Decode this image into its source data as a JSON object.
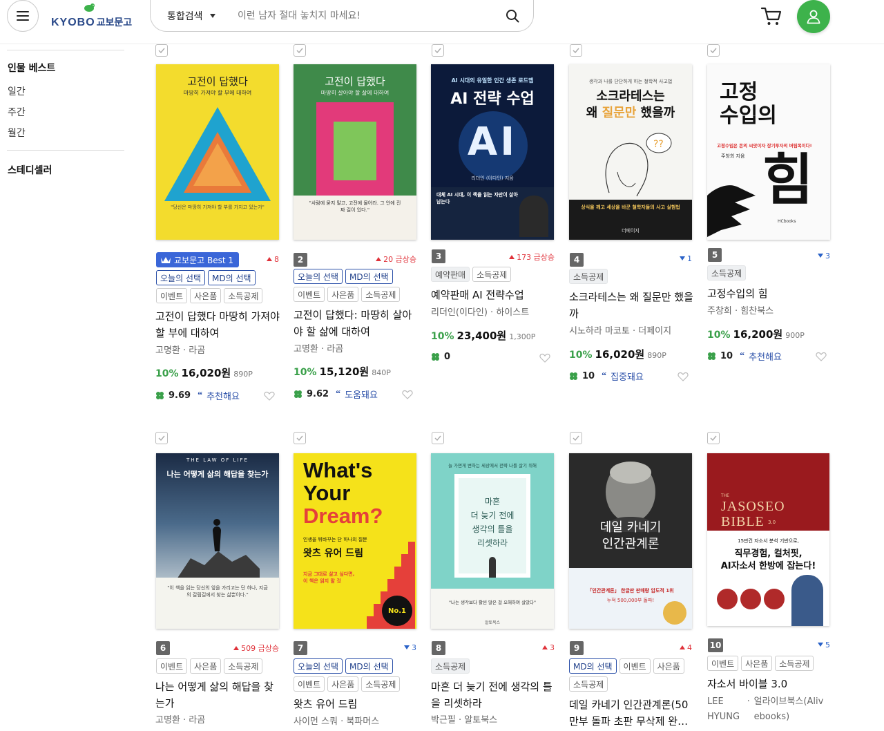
{
  "header": {
    "logo_en": "KYOBO",
    "logo_ko": "교보문고",
    "search_scope": "통합검색",
    "search_placeholder": "이런 남자 절대 놓치지 마세요!"
  },
  "sidebar": {
    "section1": "인물 베스트",
    "items": [
      "일간",
      "주간",
      "월간"
    ],
    "section2": "스테디셀러"
  },
  "books": [
    {
      "rank": "1",
      "best_badge": "교보문고 Best 1",
      "change": "8",
      "change_dir": "up",
      "tags_blue": [
        "오늘의 선택",
        "MD의 선택"
      ],
      "tags": [
        "이벤트",
        "사은품",
        "소득공제"
      ],
      "title": "고전이 답했다 마땅히 가져야 할 부에 대하여",
      "author": "고명환",
      "publisher": "라곰",
      "discount": "10%",
      "price": "16,020원",
      "points": "890P",
      "score": "9.69",
      "review": "추천해요",
      "cover": {
        "top": "고전이 답했다",
        "sub": "마땅히 가져야 할 부에 대하여",
        "quote": "\"당신은 마땅히 가져야 할 부를 가지고 있는가\"",
        "bg": "#f3dc2d"
      }
    },
    {
      "rank": "2",
      "change": "20 급상승",
      "change_dir": "up",
      "tags_blue": [
        "오늘의 선택",
        "MD의 선택"
      ],
      "tags": [
        "이벤트",
        "사은품",
        "소득공제"
      ],
      "title": "고전이 답했다: 마땅히 살아야 할 삶에 대하여",
      "author": "고명환",
      "publisher": "라곰",
      "discount": "10%",
      "price": "15,120원",
      "points": "840P",
      "score": "9.62",
      "review": "도움돼요",
      "cover": {
        "top": "고전이 답했다",
        "sub": "마땅히 살아야 할 삶에 대하여",
        "quote": "\"사람에 묻지 말고, 고전에 물어라. 그 안에 진짜 길이 있다.\"",
        "bg": "#3f8a4a"
      }
    },
    {
      "rank": "3",
      "change": "173 급상승",
      "change_dir": "up",
      "tags_gray": [
        "예약판매",
        "소득공제"
      ],
      "title": "예약판매 AI 전략수업",
      "author": "리더인(이다인)",
      "publisher": "하이스트",
      "discount": "10%",
      "price": "23,400원",
      "points": "1,300P",
      "score": "0",
      "cover": {
        "top": "AI 시대의 유일한 인간 생존 로드맵",
        "big": "AI 전략 수업",
        "ai": "AI",
        "foot": "대체 AI 시대, 이 책을 읽는 자만이 살아남는다",
        "author": "리더인 (이다인) 지음"
      }
    },
    {
      "rank": "4",
      "change": "1",
      "change_dir": "down",
      "tags_gray": [
        "소득공제"
      ],
      "title": "소크라테스는 왜 질문만 했을까",
      "author": "시노하라 마코토",
      "publisher": "더페이지",
      "discount": "10%",
      "price": "16,020원",
      "points": "890P",
      "score": "10",
      "review": "집중돼요",
      "cover": {
        "top": "생각과 나를 단단하게 하는 철학적 사고법",
        "big1": "소크라테스는",
        "big2a": "왜 ",
        "big2b": "질문만",
        "big2c": " 했을까",
        "foot": "상식을 깨고 세상을 바꾼 철학자들의 사고 실험법",
        "pub": "더페이지"
      }
    },
    {
      "rank": "5",
      "change": "3",
      "change_dir": "down",
      "tags_gray": [
        "소득공제"
      ],
      "title": "고정수입의 힘",
      "author": "주창희",
      "publisher": "힘찬북스",
      "discount": "10%",
      "price": "16,200원",
      "points": "900P",
      "score": "10",
      "review": "추천해요",
      "cover": {
        "big1": "고정",
        "big2": "수입의",
        "red": "고정수입은 돈의 씨앗이자 장기투자의 버팀목이다!",
        "author": "주창희 지음",
        "huge": "힘",
        "pub": "HCbooks"
      }
    },
    {
      "rank": "6",
      "change": "509 급상승",
      "change_dir": "up",
      "tags_gray": [
        "이벤트",
        "사은품",
        "소득공제"
      ],
      "title": "나는 어떻게 삶의 해답을 찾는가",
      "author": "고명환",
      "publisher": "라곰",
      "cover": {
        "ribbon": "THE LAW OF LIFE",
        "big": "나는 어떻게 삶의 해답을 찾는가",
        "foot": "\"이 책을 읽는 당신의 앞을 가리고는 단 하나, 지금의 갈림길에서 찾는 삶뿐이다.\""
      }
    },
    {
      "rank": "7",
      "change": "3",
      "change_dir": "down",
      "tags_blue": [
        "오늘의 선택",
        "MD의 선택"
      ],
      "tags": [
        "이벤트",
        "사은품",
        "소득공제"
      ],
      "title": "왓츠 유어 드림",
      "author": "사이먼 스쿼",
      "publisher": "북파머스",
      "cover": {
        "l1": "What's",
        "l2": "Your",
        "l3": "Dream?",
        "sub": "인생을 뒤바꾸는 단 하나의 질문",
        "ko": "왓츠 유어 드림",
        "red": "지금 그대로 살고 싶다면, 이 책은 읽지 말 것",
        "badge": "No.1"
      }
    },
    {
      "rank": "8",
      "change": "3",
      "change_dir": "up",
      "tags_gray": [
        "소득공제"
      ],
      "title": "마흔 더 늦기 전에 생각의 틀을 리셋하라",
      "author": "박근필",
      "publisher": "알토북스",
      "cover": {
        "top": "늘 가면게 변하는 세상에서 전략 나를 살기 위해",
        "l1": "마흔",
        "l2": "더 늦기 전에",
        "l3": "생각의 틀을",
        "l4": "리셋하라",
        "foot": "\"나는 생각보다 활씬 많은 걸 오해하며 살았다\"",
        "pub": "알토북스"
      }
    },
    {
      "rank": "9",
      "change": "4",
      "change_dir": "up",
      "tags_blue": [
        "MD의 선택"
      ],
      "tags": [
        "이벤트",
        "사은품"
      ],
      "tags_row2": [
        "소득공제"
      ],
      "title": "데일 카네기 인간관계론(50만부 돌파 초판 무삭제 완…",
      "author": "",
      "publisher": "",
      "cover": {
        "l1": "데일 카네기",
        "l2": "인간관계론",
        "red": "「인간관계론」 한글판 판매량 압도적 1위",
        "sub": "누적 500,000부 돌파!"
      }
    },
    {
      "rank": "10",
      "change": "5",
      "change_dir": "down",
      "tags_gray": [
        "이벤트",
        "사은품",
        "소득공제"
      ],
      "title": "자소서 바이블 3.0",
      "author": "LEE HYUNG",
      "publisher": "얼라이브북스(Aliv ebooks)",
      "cover": {
        "en1": "THE",
        "en2": "JASOSEO",
        "en3": "BIBLE",
        "ver": "3.0",
        "red1": "15만건 자소서 분석 기반으로,",
        "big1": "직무경험, 컬처핏,",
        "big2": "AI자소서 한방에 잡는다!"
      }
    }
  ],
  "colors": {
    "accent_green": "#3db24b",
    "up_red": "#e0323a",
    "down_blue": "#2a62c8",
    "brand_blue": "#2b4a8a"
  }
}
